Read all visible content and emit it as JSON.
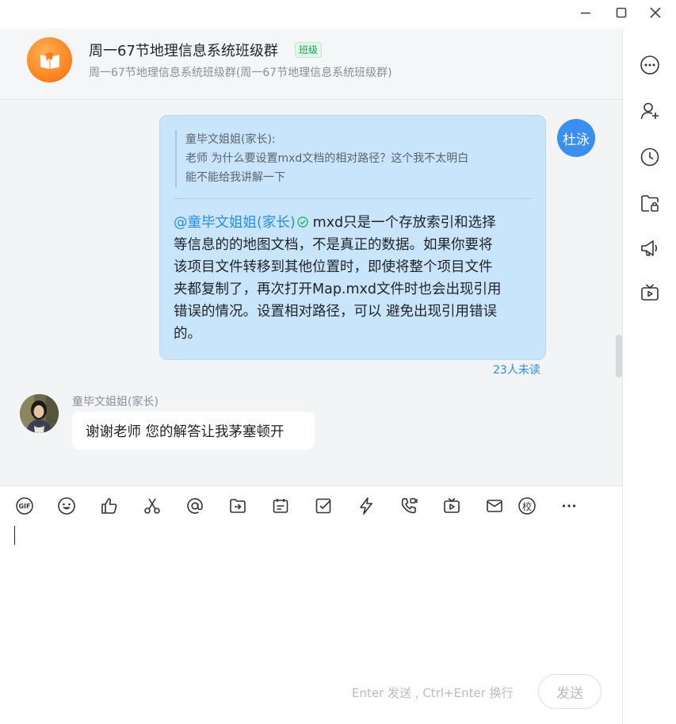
{
  "window": {
    "minimize_icon": "minimize-icon",
    "maximize_icon": "maximize-icon",
    "close_icon": "close-icon"
  },
  "header": {
    "group_name": "周一67节地理信息系统班级群",
    "group_tag": "班级",
    "group_subtitle": "周一67节地理信息系统班级群(周一67节地理信息系统班级群)"
  },
  "messages": {
    "self": {
      "avatar_text": "杜泳",
      "quote_author": "童毕文姐姐(家长):",
      "quote_lines": [
        "老师 为什么要设置mxd文档的相对路径？这个我不太明白",
        "能不能给我讲解一下"
      ],
      "mention": "@童毕文姐姐(家长)",
      "body_lines": [
        "mxd只是一个存放索引和选择",
        "等信息的的地图文档，不是真正的数据。如果你要将",
        "该项目文件转移到其他位置时，即使将整个项目文件",
        "夹都复制了，再次打开Map.mxd文件时也会出现引用",
        "错误的情况。设置相对路径，可以 避免出现引用错误",
        "的。"
      ],
      "unread": "23人未读"
    },
    "peer": {
      "name": "童毕文姐姐(家长)",
      "text": "谢谢老师 您的解答让我茅塞顿开"
    }
  },
  "composer": {
    "tools": [
      "gif-icon",
      "emoji-icon",
      "thumbs-up-icon",
      "scissors-icon",
      "at-icon",
      "forward-icon",
      "notice-icon",
      "checkbox-icon",
      "lightning-icon",
      "video-call-icon",
      "live-tv-icon",
      "mail-icon",
      "school-icon",
      "more-icon"
    ],
    "school_glyph": "校",
    "hint": "Enter 发送 , Ctrl+Enter 换行",
    "send_label": "发送"
  },
  "sidebar": {
    "items": [
      "more-options-icon",
      "add-member-icon",
      "history-icon",
      "group-files-icon",
      "announcement-icon",
      "live-icon"
    ]
  },
  "colors": {
    "accent": "#3a8ff0",
    "bubble_self": "#c9e5fb",
    "mention": "#2a8ce6",
    "group_avatar": "#ff8a26",
    "tag_green": "#1aa35c"
  }
}
